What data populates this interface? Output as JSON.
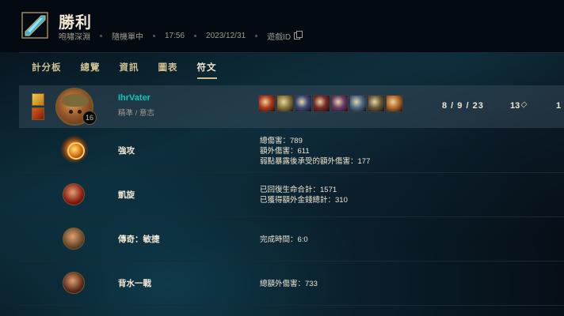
{
  "header": {
    "title": "勝利",
    "meta": [
      "咆嘯深淵",
      "隨機單中",
      "17:56",
      "2023/12/31",
      "遊戲ID"
    ]
  },
  "tabs": [
    {
      "label": "計分板",
      "active": false
    },
    {
      "label": "總覽",
      "active": false
    },
    {
      "label": "資訊",
      "active": false
    },
    {
      "label": "圖表",
      "active": false
    },
    {
      "label": "符文",
      "active": true
    }
  ],
  "player": {
    "name": "IhrVater",
    "sub": "精準 / 意志",
    "level": "16",
    "kda": "8 / 9 / 23",
    "cs": "13",
    "gold_partial": "1",
    "items": [
      {
        "name": "item-1",
        "color": "#b23a1a"
      },
      {
        "name": "item-2",
        "color": "#8a7a3a"
      },
      {
        "name": "item-3",
        "color": "#3a4a7a"
      },
      {
        "name": "item-4",
        "color": "#7a2a2a"
      },
      {
        "name": "item-5",
        "color": "#6a3a6a"
      },
      {
        "name": "item-6",
        "color": "#4a6a8a"
      },
      {
        "name": "item-7",
        "color": "#6a5a3a"
      },
      {
        "name": "item-8",
        "color": "#b86a2a"
      }
    ]
  },
  "runes": [
    {
      "name": "強攻",
      "icon": "press-the-attack-icon",
      "stats": [
        "總傷害：789",
        "額外傷害：611",
        "弱點暴露後承受的額外傷害：177"
      ]
    },
    {
      "name": "凱旋",
      "icon": "triumph-icon",
      "stats": [
        "已回復生命合計：1571",
        "已獲得額外金錢總計：310"
      ]
    },
    {
      "name": "傳奇：敏捷",
      "icon": "legend-alacrity-icon",
      "stats": [
        "完成時間：6:0"
      ]
    },
    {
      "name": "背水一戰",
      "icon": "last-stand-icon",
      "stats": [
        "總額外傷害：733"
      ]
    }
  ]
}
